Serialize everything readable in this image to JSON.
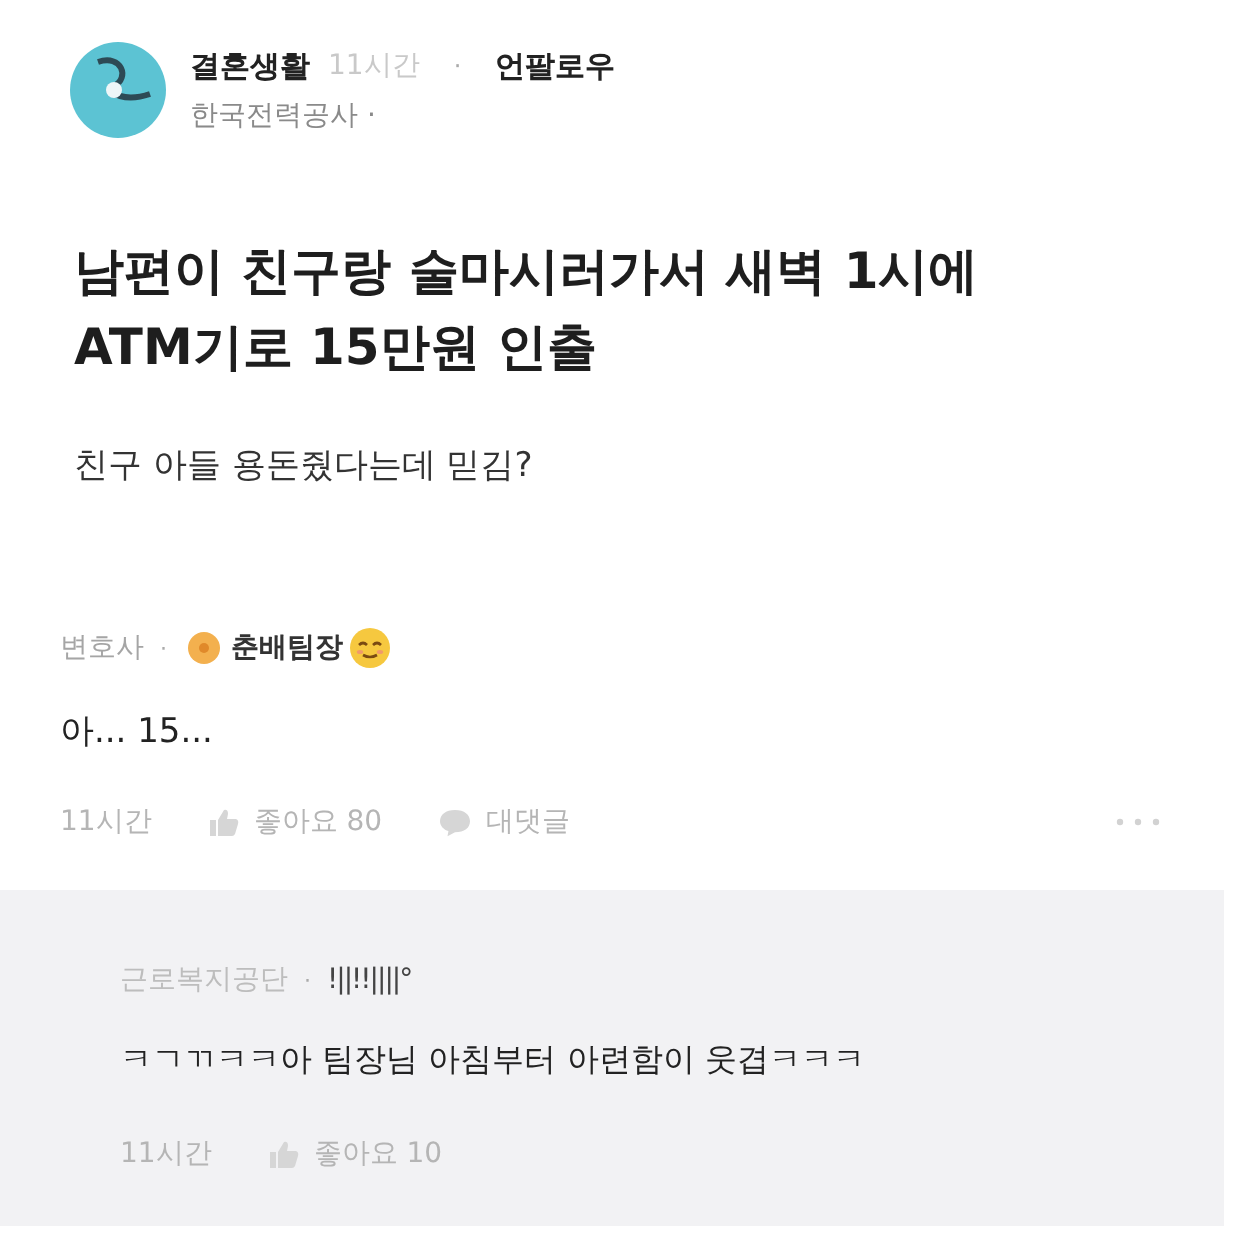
{
  "post": {
    "author": "결혼생활",
    "time": "11시간",
    "separator": "·",
    "follow": "언팔로우",
    "affiliation": "한국전력공사 ·",
    "title": "남편이 친구랑 술마시러가서 새벽 1시에 ATM기로 15만원 인출",
    "body": "친구 아들 용돈줬다는데 믿김?"
  },
  "comments": [
    {
      "kind": "comment",
      "affiliation": "변호사",
      "separator": "·",
      "author": "춘배팀장",
      "text": "아... 15...",
      "time": "11시간",
      "likes": "좋아요 80",
      "reply": "대댓글"
    },
    {
      "kind": "reply",
      "affiliation": "근로복지공단",
      "separator": "·",
      "author": "!||!!||||°",
      "text": "ㅋㄱㄲㅋㅋ아 팀장님 아침부터 아련함이 웃겹ㅋㅋㅋ",
      "time": "11시간",
      "likes": "좋아요 10"
    }
  ]
}
